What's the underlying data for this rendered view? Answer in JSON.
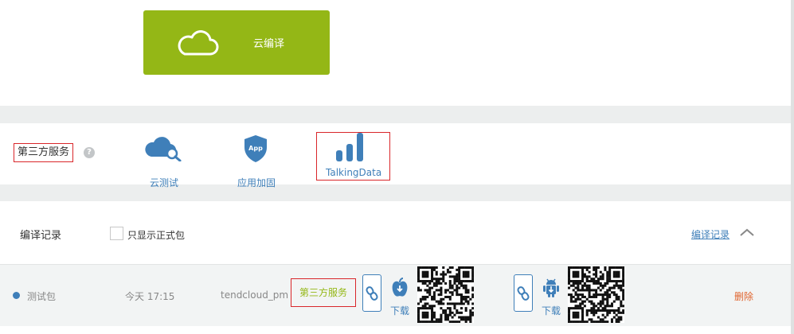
{
  "top_panel": {
    "cloud_compile_label": "云编译"
  },
  "third_party": {
    "title": "第三方服务",
    "help_icon": "?",
    "services": [
      {
        "label": "云测试",
        "icon": "cloud-search-icon"
      },
      {
        "label": "应用加固",
        "icon": "app-shield-icon",
        "badge": "App"
      },
      {
        "label": "TalkingData",
        "icon": "bar-chart-icon"
      }
    ]
  },
  "records": {
    "title": "编译记录",
    "filter_label": "只显示正式包",
    "filter_checked": false,
    "link_label": "编译记录",
    "rows": [
      {
        "name": "测试包",
        "time": "今天 17:15",
        "account": "tendcloud_pm",
        "third_party_button": "第三方服务",
        "ios_download": "下载",
        "android_download": "下载",
        "delete": "删除"
      }
    ]
  },
  "colors": {
    "accent_green": "#94b716",
    "link_blue": "#3f7fb9",
    "highlight_red": "#d9262a",
    "delete_orange": "#e0642e"
  }
}
